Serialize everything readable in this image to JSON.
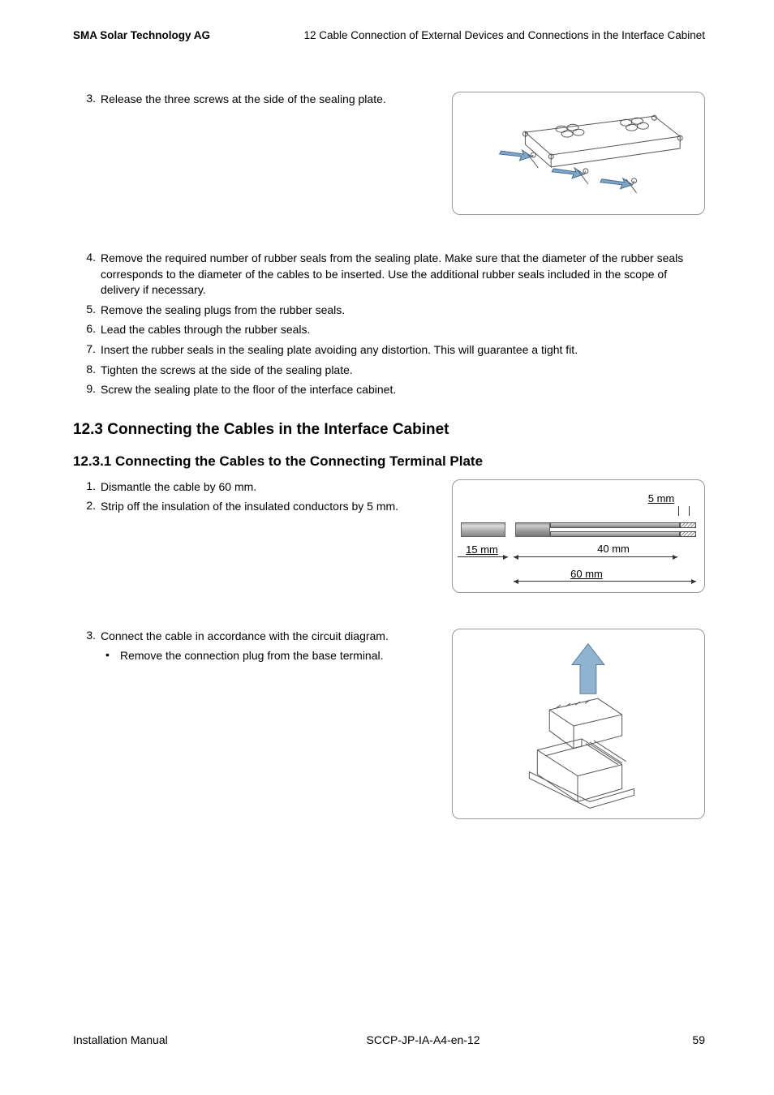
{
  "header": {
    "company": "SMA Solar Technology AG",
    "chapter": "12  Cable Connection of External Devices and Connections in the Interface Cabinet"
  },
  "stepsA": [
    {
      "num": "3.",
      "text": "Release the three screws at the side of the sealing plate."
    }
  ],
  "stepsB": [
    {
      "num": "4.",
      "text": "Remove the required number of rubber seals from the sealing plate. Make sure that the diameter of the rubber seals corresponds to the diameter of the cables to be inserted. Use the additional rubber seals included in the scope of delivery if necessary."
    },
    {
      "num": "5.",
      "text": "Remove the sealing plugs from the rubber seals."
    },
    {
      "num": "6.",
      "text": "Lead the cables through the rubber seals."
    },
    {
      "num": "7.",
      "text": "Insert the rubber seals in the sealing plate avoiding any distortion. This will guarantee a tight fit."
    },
    {
      "num": "8.",
      "text": "Tighten the screws at the side of the sealing plate."
    },
    {
      "num": "9.",
      "text": "Screw the sealing plate to the floor of the interface cabinet."
    }
  ],
  "h2": "12.3 Connecting the Cables in the Interface Cabinet",
  "h3": "12.3.1  Connecting the Cables to the Connecting Terminal Plate",
  "stepsC": [
    {
      "num": "1.",
      "text": "Dismantle the cable by 60 mm."
    },
    {
      "num": "2.",
      "text": "Strip off the insulation of the insulated conductors by 5 mm."
    }
  ],
  "stepsD": [
    {
      "num": "3.",
      "text": "Connect the cable in accordance with the circuit diagram."
    }
  ],
  "bulletD": "Remove the connection plug from the base terminal.",
  "wire_labels": {
    "l5": "5 mm",
    "l15": "15 mm",
    "l40": "40 mm",
    "l60": "60 mm"
  },
  "footer": {
    "left": "Installation Manual",
    "center": "SCCP-JP-IA-A4-en-12",
    "right": "59"
  }
}
